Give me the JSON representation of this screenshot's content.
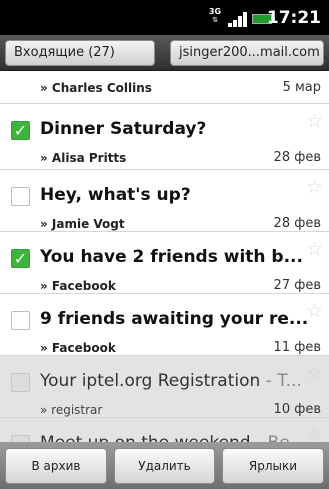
{
  "status_bar": {
    "network": "3G",
    "network_arrows": "⇅",
    "time": "17:21"
  },
  "header": {
    "inbox_label": "Входящие (27)",
    "account_label": "jsinger200...mail.com"
  },
  "messages": [
    {
      "subject": "",
      "snippet": "",
      "sender": "» Charles Collins",
      "date": "5 мар",
      "checked": false,
      "read": false
    },
    {
      "subject": "Dinner Saturday?",
      "snippet": "",
      "sender": "» Alisa Pritts",
      "date": "28 фев",
      "checked": true,
      "read": false
    },
    {
      "subject": "Hey, what's up?",
      "snippet": "",
      "sender": "» Jamie Vogt",
      "date": "28 фев",
      "checked": false,
      "read": false
    },
    {
      "subject": "You have 2 friends with b...",
      "snippet": "",
      "sender": "» Facebook",
      "date": "27 фев",
      "checked": true,
      "read": false
    },
    {
      "subject": "9 friends awaiting your re...",
      "snippet": "",
      "sender": "» Facebook",
      "date": "11 фев",
      "checked": false,
      "read": false
    },
    {
      "subject": "Your iptel.org Registration",
      "snippet": " - T...",
      "sender": "» registrar",
      "date": "10 фев",
      "checked": false,
      "read": true
    },
    {
      "subject": "Meet up on the weekend",
      "snippet": " - Be...",
      "sender": "",
      "date": "",
      "checked": false,
      "read": true
    }
  ],
  "actions": {
    "archive": "В архив",
    "delete": "Удалить",
    "labels": "Ярлыки"
  },
  "colors": {
    "checkbox_checked": "#3db53d",
    "read_row_bg": "#e3e3e3",
    "header_bg": "#3a3a3a"
  },
  "icons": {
    "star": "star-icon",
    "check": "checkmark-icon"
  }
}
